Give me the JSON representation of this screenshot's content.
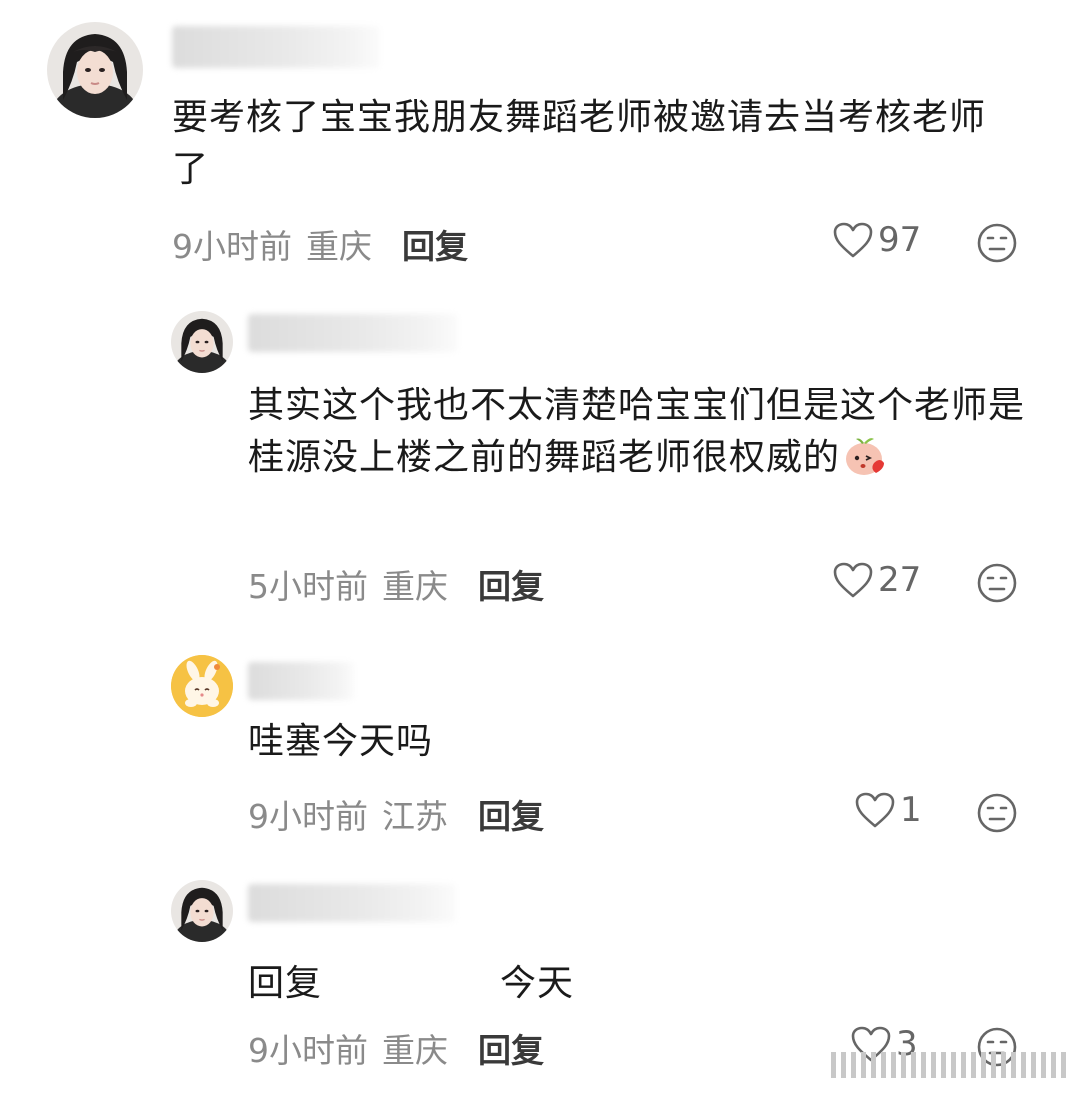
{
  "comments": [
    {
      "text": "要考核了宝宝我朋友舞蹈老师被邀请去当考核老师了",
      "time": "9小时前",
      "location": "重庆",
      "reply_label": "回复",
      "likes": "97"
    },
    {
      "text": "其实这个我也不太清楚哈宝宝们但是这个老师是桂源没上楼之前的舞蹈老师很权威的",
      "time": "5小时前",
      "location": "重庆",
      "reply_label": "回复",
      "likes": "27"
    },
    {
      "text": "哇塞今天吗",
      "time": "9小时前",
      "location": "江苏",
      "reply_label": "回复",
      "likes": "1"
    },
    {
      "text_left": "回复",
      "text_right": "今天",
      "time": "9小时前",
      "location": "重庆",
      "reply_label": "回复",
      "likes": "3"
    }
  ],
  "colors": {
    "meta_gray": "#8a8a8a",
    "reply_dark": "#3a3a3a",
    "icon_gray": "#666666",
    "avatar_yellow": "#f6c244"
  },
  "icons": {
    "like": "heart-outline-icon",
    "dislike": "neutral-face-icon",
    "sticker": "peach-sticker-icon"
  }
}
